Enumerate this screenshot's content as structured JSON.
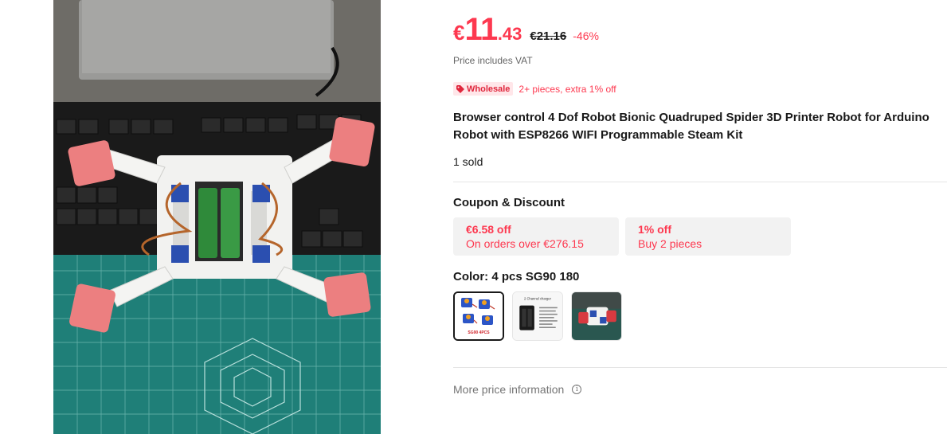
{
  "price": {
    "currency": "€",
    "integer": "11",
    "decimal": ".43",
    "original": "€21.16",
    "discount": "-46%",
    "vat_note": "Price includes VAT"
  },
  "wholesale": {
    "tag_label": "Wholesale",
    "text": "2+ pieces, extra 1% off",
    "icon": "tag-icon"
  },
  "product": {
    "title": "Browser control 4 Dof Robot Bionic Quadruped Spider 3D Printer Robot for Arduino Robot with ESP8266 WIFI Programmable Steam Kit",
    "sold": "1 sold"
  },
  "coupons": {
    "title": "Coupon & Discount",
    "items": [
      {
        "amount": "€6.58 off",
        "condition": "On orders over €276.15"
      },
      {
        "amount": "1% off",
        "condition": "Buy 2 pieces"
      }
    ]
  },
  "color": {
    "label": "Color: 4 pcs SG90 180",
    "options": [
      {
        "name": "4 pcs SG90 180",
        "selected": true,
        "caption": "SG90 4PCS"
      },
      {
        "name": "2 Channel charger",
        "selected": false,
        "caption": "2 Channel charger"
      },
      {
        "name": "Robot photo",
        "selected": false,
        "caption": ""
      }
    ]
  },
  "more_price": {
    "label": "More price information",
    "icon": "info-icon"
  },
  "colors": {
    "accent": "#fd384f",
    "text": "#191919",
    "muted": "#666666",
    "coupon_bg": "#f2f2f2",
    "wholesale_bg": "#ffe6e9"
  }
}
